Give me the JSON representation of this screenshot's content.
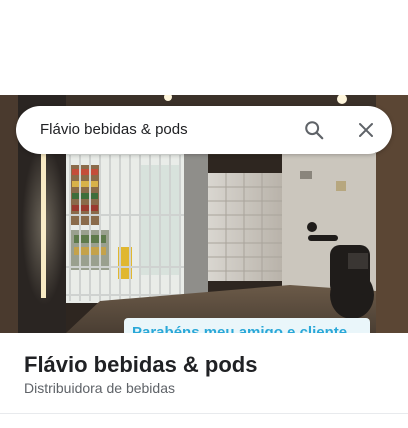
{
  "search": {
    "query": "Flávio bebidas & pods",
    "search_icon": "search-icon",
    "close_icon": "close-icon"
  },
  "photo": {
    "banner_text": "Parabéns meu amigo e cliente"
  },
  "place": {
    "name": "Flávio bebidas & pods",
    "category": "Distribuidora de bebidas"
  },
  "colors": {
    "banner_text": "#2aa8d8",
    "title_text": "#202124",
    "secondary_text": "#5f6368"
  }
}
